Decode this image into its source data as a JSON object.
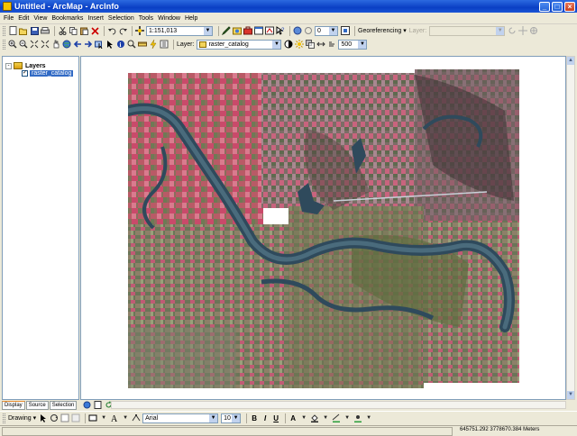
{
  "window": {
    "title": "Untitled - ArcMap - ArcInfo",
    "buttons": {
      "minimize": "_",
      "maximize": "□",
      "close": "×"
    }
  },
  "menu": [
    "File",
    "Edit",
    "View",
    "Bookmarks",
    "Insert",
    "Selection",
    "Tools",
    "Window",
    "Help"
  ],
  "standard_toolbar": {
    "scale_value": "1:151,013",
    "icons": [
      "new-icon",
      "open-icon",
      "save-icon",
      "print-icon",
      "cut-icon",
      "copy-icon",
      "paste-icon",
      "delete-icon",
      "undo-icon",
      "redo-icon",
      "add-data-icon"
    ],
    "editor_icons": [
      "editor-icon",
      "catalog-icon",
      "arctoolbox-icon"
    ],
    "georef_count_value": "0",
    "georeferencing_label": "Georeferencing ▾",
    "layer_label_disabled": "Layer:"
  },
  "tools_toolbar": {
    "layer_label": "Layer:",
    "layer_value": "raster_catalog",
    "transparency_value": "500",
    "icons": [
      "zoom-in-icon",
      "zoom-out-icon",
      "fixed-zoom-in-icon",
      "fixed-zoom-out-icon",
      "pan-icon",
      "full-extent-icon",
      "back-icon",
      "forward-icon",
      "select-icon",
      "identify-icon",
      "find-icon",
      "measure-icon",
      "hyperlink-icon"
    ]
  },
  "toc": {
    "root_label": "Layers",
    "root_expander": "-",
    "layers": [
      {
        "name": "raster_catalog",
        "checked": true,
        "check_mark": "✓"
      }
    ],
    "tabs": [
      "Display",
      "Source",
      "Selection"
    ]
  },
  "drawing_toolbar": {
    "drawing_label": "Drawing ▾",
    "font_name": "Arial",
    "font_size": "10",
    "bold": "B",
    "italic": "I",
    "underline": "U",
    "text_color_glyph": "A"
  },
  "status": {
    "coordinates": "645751.292 3778670.384 Meters"
  },
  "colors": {
    "title_bar": "#0a3fc4",
    "selection": "#316ac5",
    "chrome": "#ece9d8"
  }
}
